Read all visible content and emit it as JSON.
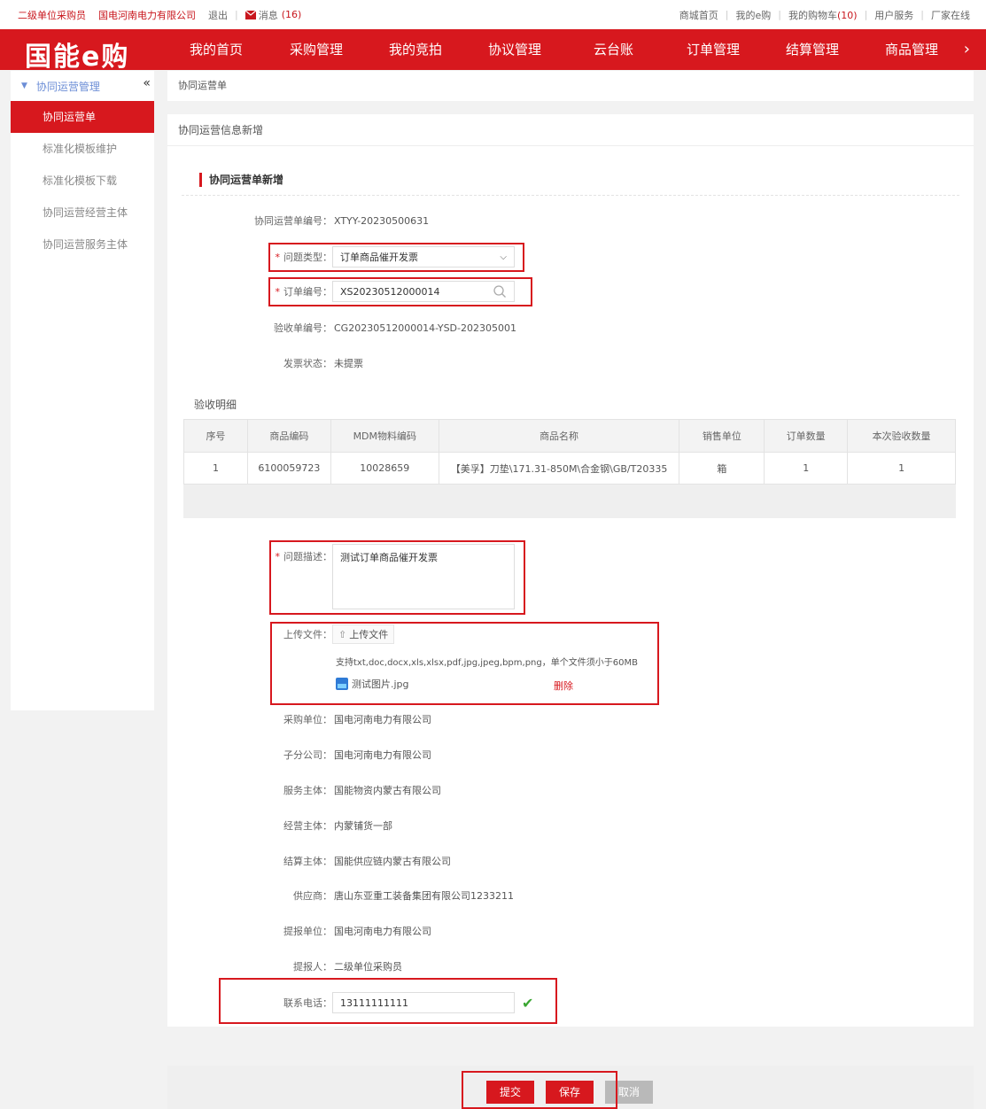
{
  "topbar": {
    "user_role": "二级单位采购员",
    "company": "国电河南电力有限公司",
    "logout": "退出",
    "messages_label": "消息",
    "messages_count": "(16)",
    "right_links": [
      {
        "label": "商城首页"
      },
      {
        "label": "我的e购"
      },
      {
        "label": "我的购物车",
        "count": "(10)"
      },
      {
        "label": "用户服务"
      },
      {
        "label": "厂家在线"
      }
    ]
  },
  "nav": {
    "logo": "国能e购",
    "items": [
      "我的首页",
      "采购管理",
      "我的竞拍",
      "协议管理",
      "云台账",
      "订单管理",
      "结算管理",
      "商品管理"
    ],
    "more": "›"
  },
  "sidebar": {
    "section": "协同运营管理",
    "collapse": "«",
    "items": [
      "协同运营单",
      "标准化模板维护",
      "标准化模板下载",
      "协同运营经营主体",
      "协同运营服务主体"
    ]
  },
  "breadcrumb": "协同运营单",
  "panel": {
    "title": "协同运营信息新增",
    "subtitle": "协同运营单新增"
  },
  "form": {
    "order_no_label": "协同运营单编号：",
    "order_no": "XTYY-20230500631",
    "issue_type_label": "问题类型：",
    "issue_type": "订单商品催开发票",
    "order_code_label": "订单编号：",
    "order_code": "XS20230512000014",
    "acceptance_no_label": "验收单编号：",
    "acceptance_no": "CG20230512000014-YSD-202305001",
    "invoice_status_label": "发票状态：",
    "invoice_status": "未提票",
    "detail_label": "验收明细",
    "desc_label": "问题描述：",
    "desc": "测试订单商品催开发票",
    "upload_label": "上传文件：",
    "upload_button": "上传文件",
    "upload_hint": "支持txt,doc,docx,xls,xlsx,pdf,jpg,jpeg,bpm,png，单个文件须小于60MB",
    "file_name": "测试图片.jpg",
    "delete": "删除",
    "info": [
      {
        "label": "采购单位：",
        "value": "国电河南电力有限公司"
      },
      {
        "label": "子分公司：",
        "value": "国电河南电力有限公司"
      },
      {
        "label": "服务主体：",
        "value": "国能物资内蒙古有限公司"
      },
      {
        "label": "经营主体：",
        "value": "内蒙铺货一部"
      },
      {
        "label": "结算主体：",
        "value": "国能供应链内蒙古有限公司"
      },
      {
        "label": "供应商：",
        "value": "唐山东亚重工装备集团有限公司1233211"
      },
      {
        "label": "提报单位：",
        "value": "国电河南电力有限公司"
      },
      {
        "label": "提报人：",
        "value": "二级单位采购员"
      }
    ],
    "phone_label": "联系电话：",
    "phone": "13111111111"
  },
  "table": {
    "headers": [
      "序号",
      "商品编码",
      "MDM物料编码",
      "商品名称",
      "销售单位",
      "订单数量",
      "本次验收数量"
    ],
    "rows": [
      [
        "1",
        "6100059723",
        "10028659",
        "【美孚】刀垫\\171.31-850M\\合金钢\\GB/T20335",
        "箱",
        "1",
        "1"
      ]
    ]
  },
  "buttons": {
    "submit": "提交",
    "save": "保存",
    "cancel": "取消"
  },
  "colors": {
    "brand": "#d7181e",
    "success": "#3aa632"
  }
}
